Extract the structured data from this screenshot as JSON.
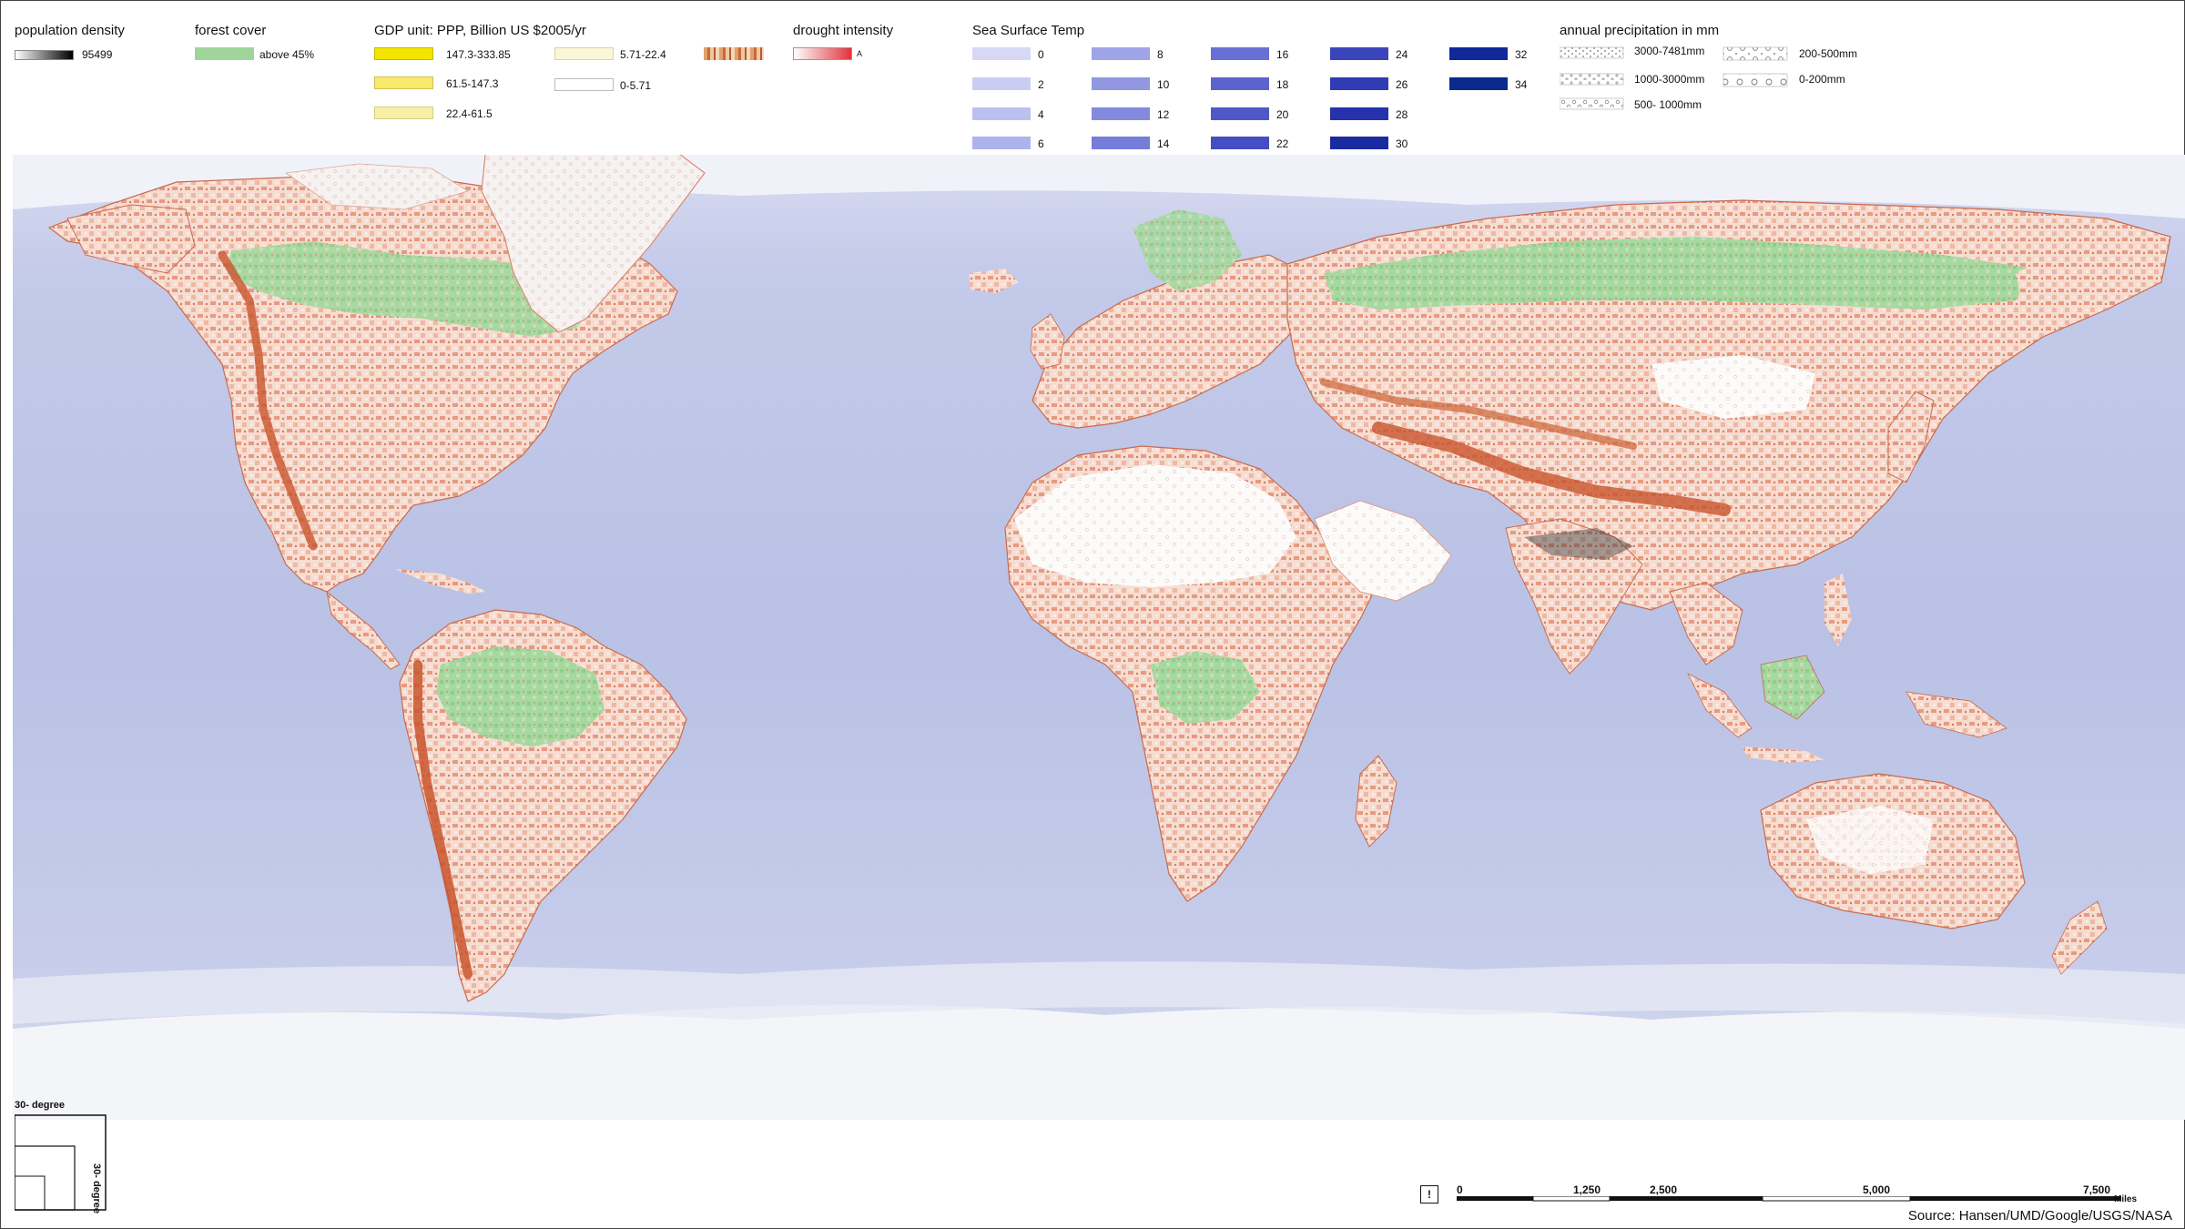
{
  "legend": {
    "population": {
      "title": "population density",
      "max_label": "95499"
    },
    "forest": {
      "title": "forest cover",
      "label": "above 45%",
      "color": "#9fd59a"
    },
    "gdp": {
      "title": "GDP unit: PPP, Billion US $2005/yr",
      "classes": [
        {
          "label": "147.3-333.85",
          "color": "#f4e400"
        },
        {
          "label": "61.5-147.3",
          "color": "#f7ea6a"
        },
        {
          "label": "22.4-61.5",
          "color": "#f9f0a8"
        },
        {
          "label": "5.71-22.4",
          "color": "#fbf6d8"
        },
        {
          "label": "0-5.71",
          "color": "#ffffff"
        }
      ]
    },
    "drought": {
      "title": "drought intensity",
      "marker": "A"
    },
    "sst": {
      "title": "Sea Surface Temp",
      "classes": [
        {
          "label": "0",
          "color": "#d6d8f6"
        },
        {
          "label": "2",
          "color": "#cacdf3"
        },
        {
          "label": "4",
          "color": "#bcc0ef"
        },
        {
          "label": "6",
          "color": "#aeb3ec"
        },
        {
          "label": "8",
          "color": "#9ea4e6"
        },
        {
          "label": "10",
          "color": "#9197e1"
        },
        {
          "label": "12",
          "color": "#838ade"
        },
        {
          "label": "14",
          "color": "#757dd8"
        },
        {
          "label": "16",
          "color": "#6870d3"
        },
        {
          "label": "18",
          "color": "#5b64cd"
        },
        {
          "label": "20",
          "color": "#4f58c7"
        },
        {
          "label": "22",
          "color": "#444dc1"
        },
        {
          "label": "24",
          "color": "#3a45bb"
        },
        {
          "label": "26",
          "color": "#303cb4"
        },
        {
          "label": "28",
          "color": "#2532ab"
        },
        {
          "label": "30",
          "color": "#1a2ba2"
        },
        {
          "label": "32",
          "color": "#11289a"
        },
        {
          "label": "34",
          "color": "#0a2a8e"
        }
      ]
    },
    "precip": {
      "title": "annual precipitation in mm",
      "classes": [
        {
          "label": "3000-7481mm"
        },
        {
          "label": "1000-3000mm"
        },
        {
          "label": "500- 1000mm"
        },
        {
          "label": "200-500mm"
        },
        {
          "label": "0-200mm"
        }
      ]
    }
  },
  "grid_inset": {
    "title": "30- degree",
    "side_label": "30- degree"
  },
  "scale": {
    "ticks": [
      "0",
      "1,250",
      "2,500",
      "5,000",
      "7,500"
    ],
    "unit": "Miles",
    "north_marker": "!"
  },
  "source": "Source:  Hansen/UMD/Google/USGS/NASA",
  "colors": {
    "ocean": "#bcc4e6",
    "ocean_light": "#d2d6ef",
    "polar": "#eef0f6",
    "land_base": "#f7e4dc",
    "terracotta": "#d96a45",
    "forest": "#9fd59a",
    "desert": "#ffffff"
  }
}
